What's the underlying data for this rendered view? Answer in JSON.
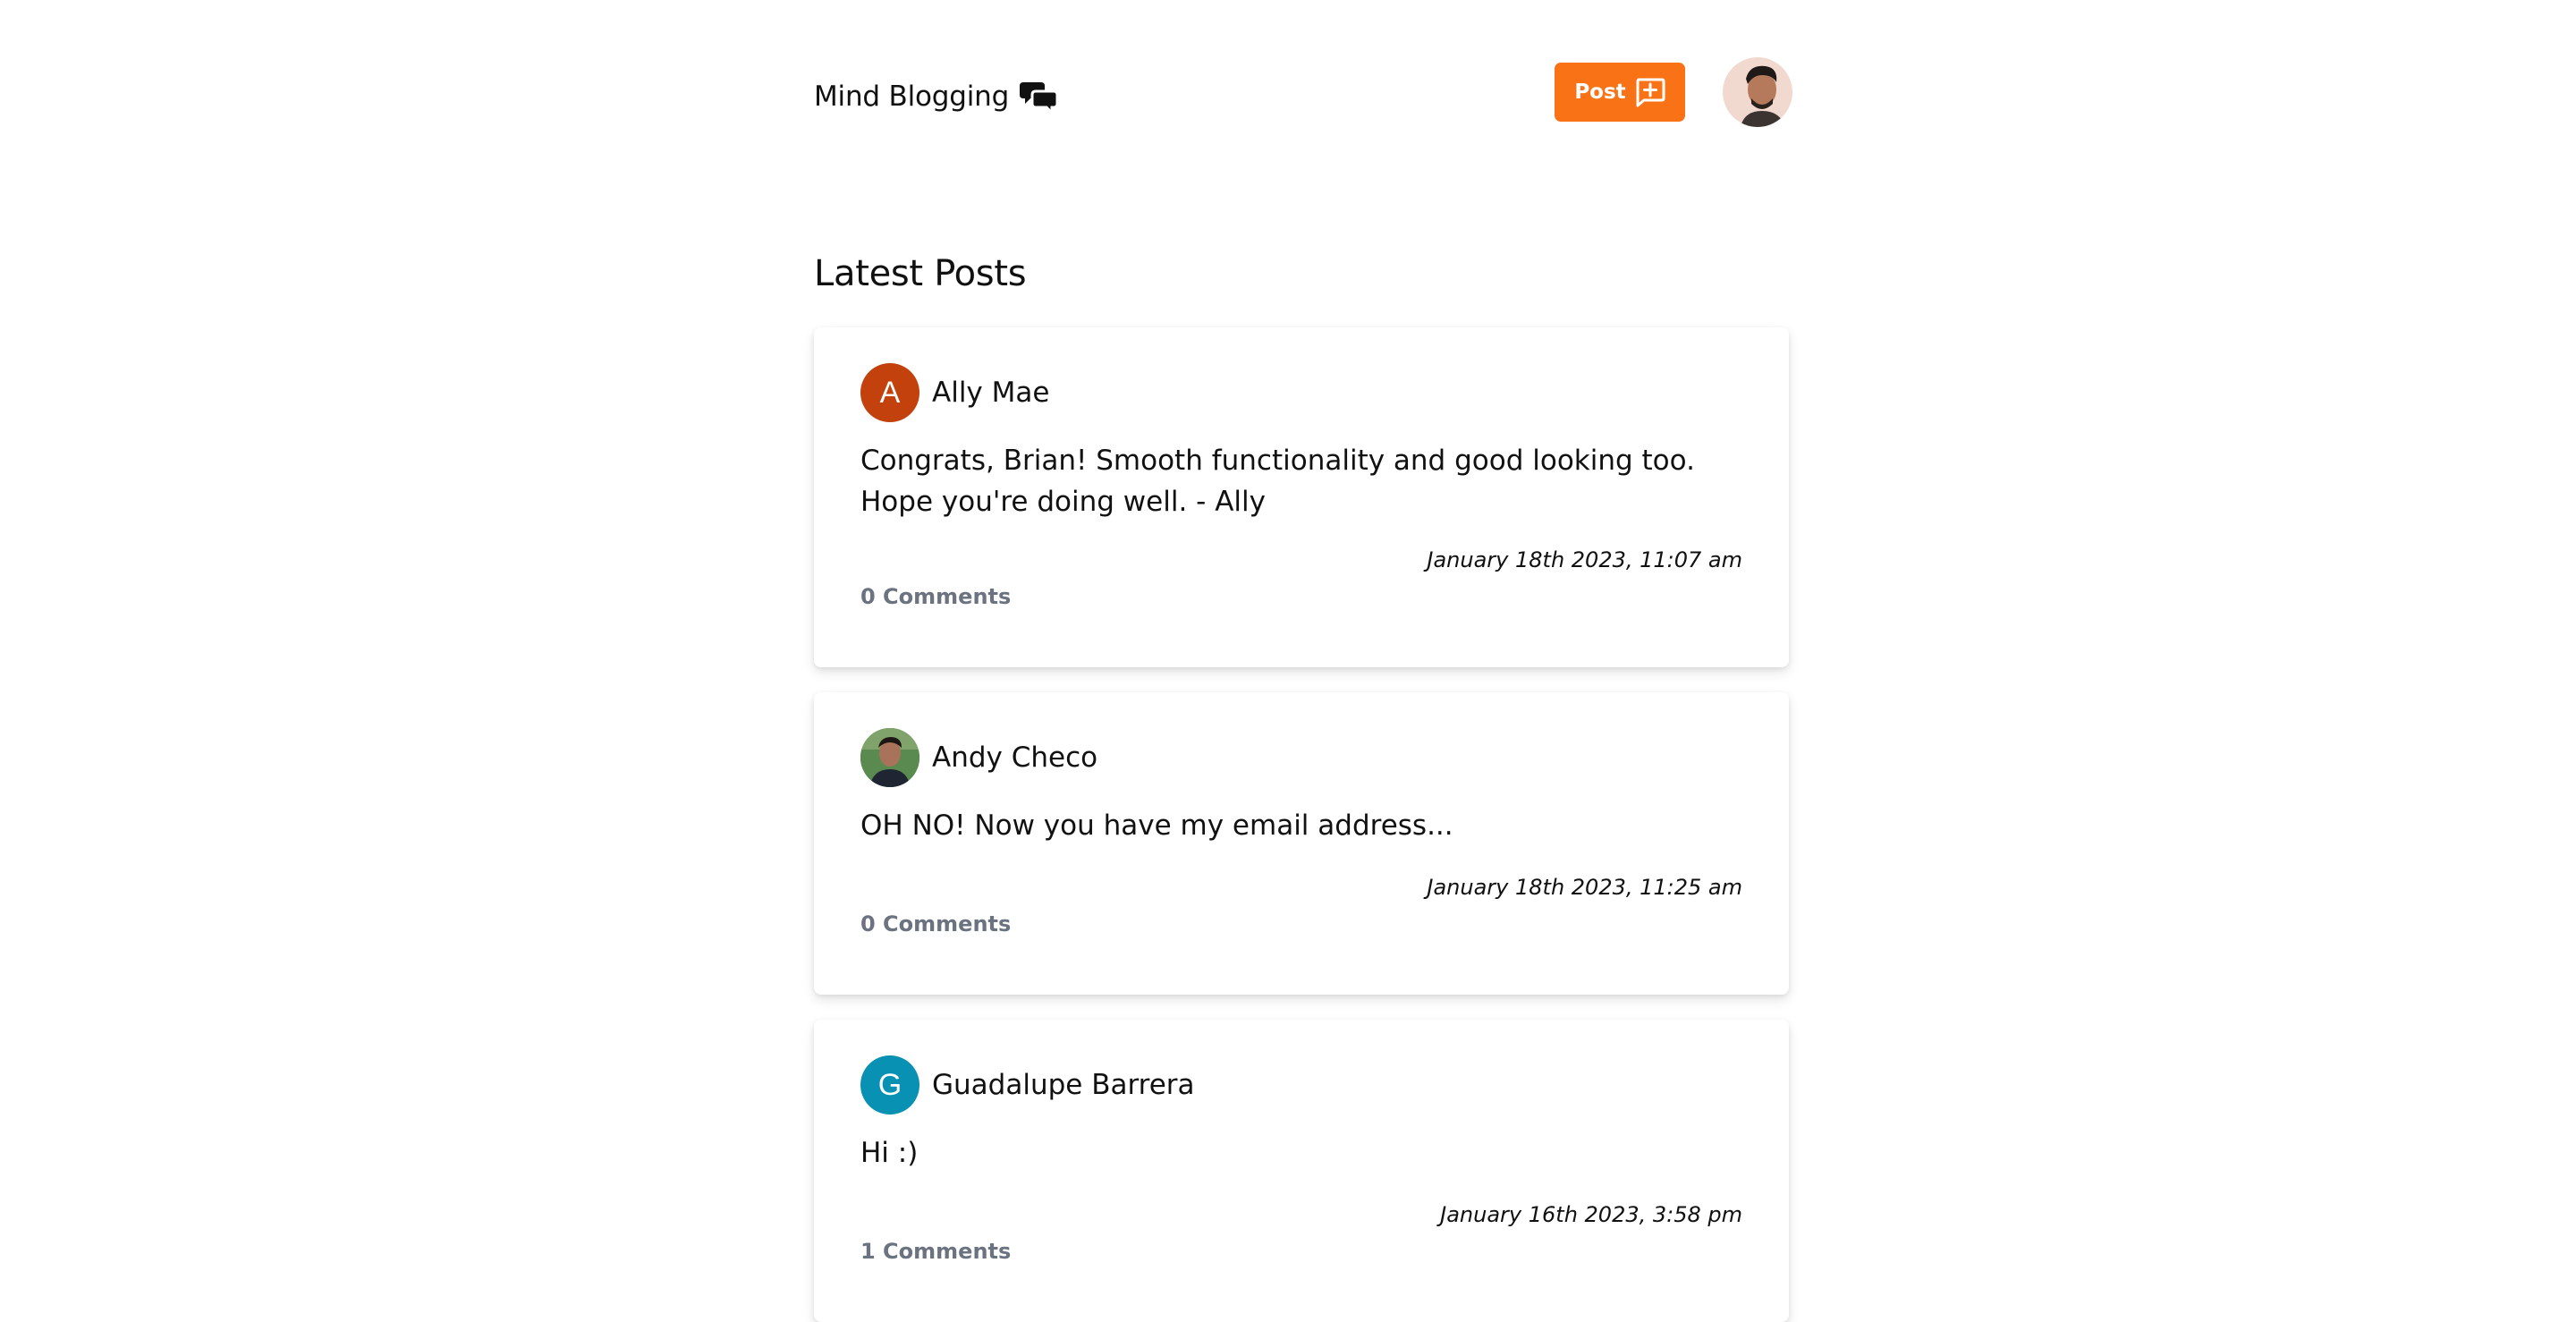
{
  "header": {
    "brand_title": "Mind Blogging",
    "brand_icon": "chat-bubbles-icon",
    "post_button_label": "Post",
    "post_button_icon": "add-comment-icon",
    "accent_color": "#f97316"
  },
  "main": {
    "section_title": "Latest Posts",
    "posts": [
      {
        "author": "Ally Mae",
        "avatar_initial": "A",
        "avatar_color": "#c2410c",
        "content": "Congrats, Brian! Smooth functionality and good looking too. Hope you're doing well. - Ally",
        "timestamp": "January 18th 2023, 11:07 am",
        "comments": "0 Comments"
      },
      {
        "author": "Andy Checo",
        "avatar_initial": "",
        "avatar_color": "#3f6b3a",
        "content": "OH NO! Now you have my email address...",
        "timestamp": "January 18th 2023, 11:25 am",
        "comments": "0 Comments"
      },
      {
        "author": "Guadalupe Barrera",
        "avatar_initial": "G",
        "avatar_color": "#0891b2",
        "content": "Hi :)",
        "timestamp": "January 16th 2023, 3:58 pm",
        "comments": "1 Comments"
      }
    ]
  }
}
